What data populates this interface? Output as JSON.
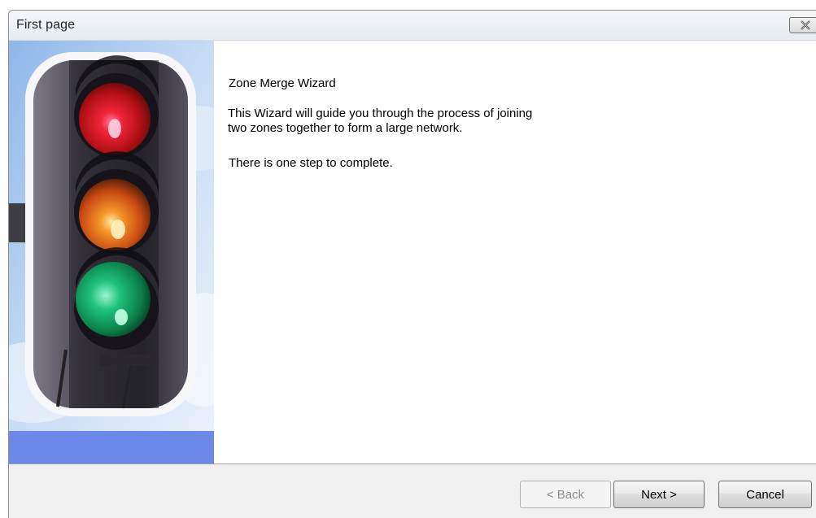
{
  "window": {
    "title": "First page",
    "close_icon": "close-icon"
  },
  "side_panel": {
    "image": "traffic-light-image",
    "colors": {
      "sky": "#a9c9ef",
      "strip": "#6c89ea",
      "light_red": "#d81818",
      "light_amber": "#e8731a",
      "light_green": "#0ea25e"
    }
  },
  "wizard": {
    "title": "Zone Merge Wizard",
    "description": "This Wizard will guide you through the process of joining\ntwo zones together to form a large network.",
    "steps_text": "There is one step to complete."
  },
  "buttons": {
    "back_label": "< Back",
    "back_enabled": false,
    "next_label": "Next >",
    "cancel_label": "Cancel"
  }
}
